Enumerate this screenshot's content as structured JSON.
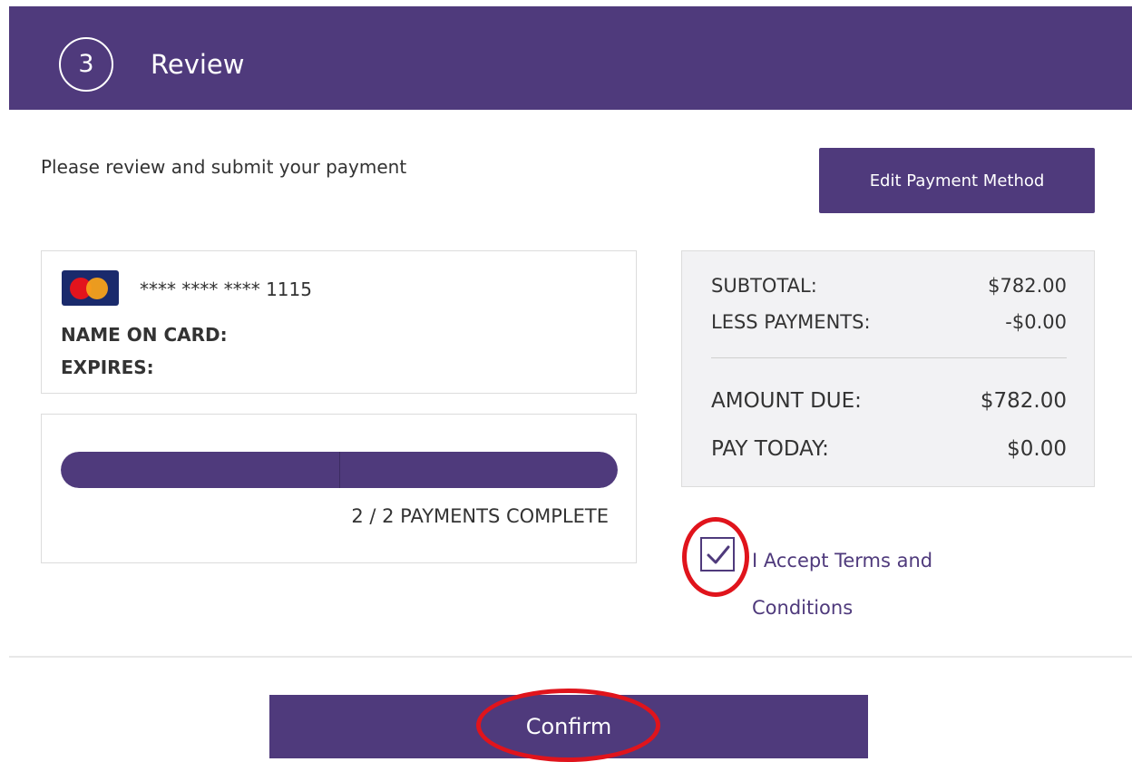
{
  "header": {
    "step_number": "3",
    "title": "Review"
  },
  "intro": {
    "text": "Please review and submit your payment"
  },
  "edit_button": {
    "label": "Edit Payment Method"
  },
  "card": {
    "brand_icon": "mastercard-icon",
    "number_masked": "**** **** **** 1115",
    "name_label": "NAME ON CARD:",
    "expires_label": "EXPIRES:"
  },
  "progress": {
    "completed": 2,
    "total": 2,
    "fraction": 1.0,
    "label": "2 / 2 PAYMENTS COMPLETE"
  },
  "summary": {
    "rows": [
      {
        "label": "SUBTOTAL:",
        "value": "$782.00"
      },
      {
        "label": "LESS PAYMENTS:",
        "value": "-$0.00"
      },
      {
        "label": "AMOUNT DUE:",
        "value": "$782.00"
      },
      {
        "label": "PAY TODAY:",
        "value": "$0.00"
      }
    ]
  },
  "terms": {
    "checked": true,
    "label": "I Accept Terms and Conditions"
  },
  "confirm_button": {
    "label": "Confirm"
  },
  "colors": {
    "brand": "#4f3a7c",
    "annotation": "#e0141c"
  }
}
